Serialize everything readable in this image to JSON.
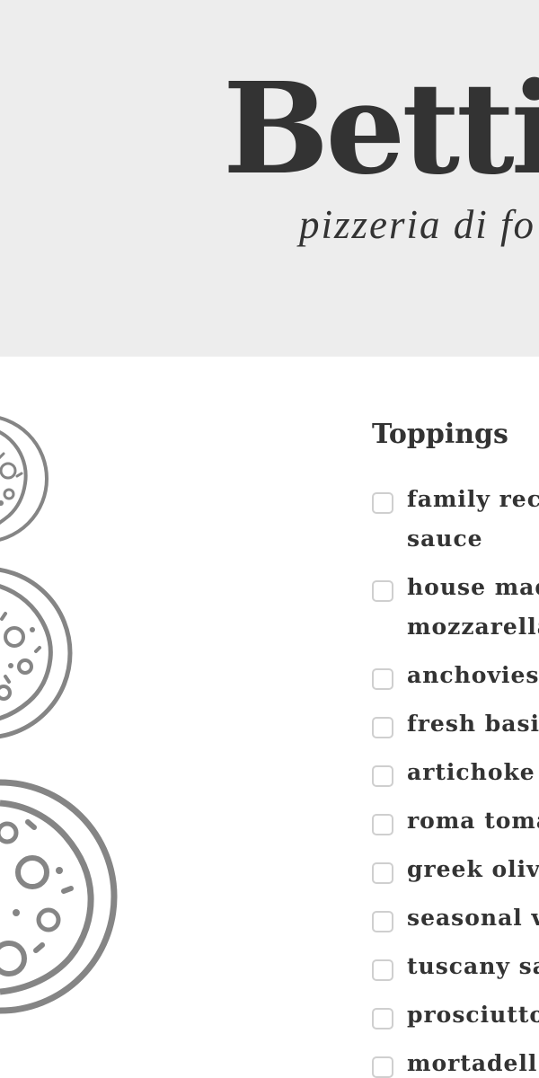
{
  "hero": {
    "brand": "Bettin",
    "tagline": "pizzeria di fo"
  },
  "sizes": {
    "icon_color": "#858585",
    "items": [
      {
        "name": "small-pizza-icon"
      },
      {
        "name": "medium-pizza-icon"
      },
      {
        "name": "large-pizza-icon"
      }
    ]
  },
  "toppings": {
    "title": "Toppings",
    "items": [
      {
        "label": "family recipe sauce",
        "checked": false
      },
      {
        "label": "house made mozzarella",
        "checked": false
      },
      {
        "label": "anchovies",
        "checked": false
      },
      {
        "label": "fresh basil",
        "checked": false
      },
      {
        "label": "artichoke",
        "checked": false
      },
      {
        "label": "roma tomato",
        "checked": false
      },
      {
        "label": "greek olive",
        "checked": false
      },
      {
        "label": "seasonal v",
        "checked": false
      },
      {
        "label": "tuscany sa",
        "checked": false
      },
      {
        "label": "prosciutto",
        "checked": false
      },
      {
        "label": "mortadell",
        "checked": false
      }
    ]
  },
  "colors": {
    "hero_bg": "#ededed",
    "text": "#333333",
    "checkbox_border": "#cfcfcf"
  }
}
